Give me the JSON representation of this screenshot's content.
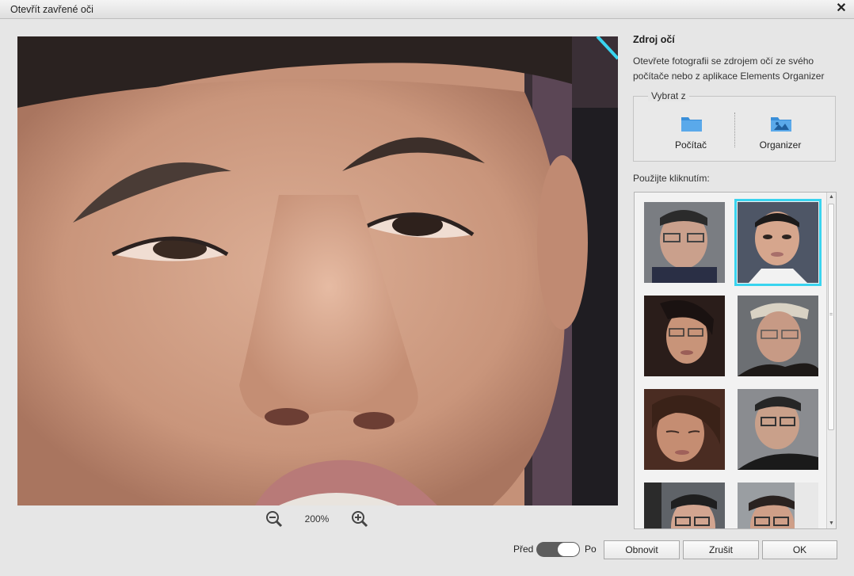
{
  "window": {
    "title": "Otevřít zavřené oči",
    "close_icon": "close-icon"
  },
  "preview": {
    "zoom_label": "200%",
    "zoom_out_icon": "zoom-out-icon",
    "zoom_in_icon": "zoom-in-icon"
  },
  "side": {
    "heading": "Zdroj očí",
    "description": "Otevřete fotografii se zdrojem očí ze svého počítače nebo z aplikace Elements Organizer",
    "source_group": {
      "legend": "Vybrat z",
      "computer_label": "Počítač",
      "computer_icon": "folder-icon",
      "organizer_label": "Organizer",
      "organizer_icon": "photo-folder-icon"
    },
    "pick_label": "Použijte kliknutím:",
    "selected_thumbnail": 2,
    "thumbnails": [
      "face-1",
      "face-2",
      "face-3",
      "face-4",
      "face-5",
      "face-6",
      "face-7",
      "face-8"
    ]
  },
  "footer": {
    "toggle_before": "Před",
    "toggle_after": "Po",
    "toggle_state": "Po",
    "reset_label": "Obnovit",
    "cancel_label": "Zrušit",
    "ok_label": "OK"
  },
  "colors": {
    "accent": "#3ad4ef",
    "toggle_track": "#5d5d5d",
    "folder_blue": "#3a8fd9"
  }
}
